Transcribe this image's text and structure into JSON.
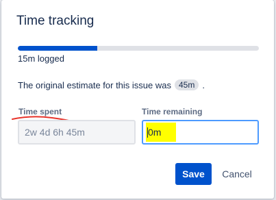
{
  "dialog": {
    "title": "Time tracking",
    "progress_fraction": 0.33,
    "logged_text": "15m logged",
    "estimate_text": "The original estimate for this issue was",
    "estimate_value": "45m",
    "estimate_suffix": "."
  },
  "fields": {
    "time_spent": {
      "label": "Time spent",
      "placeholder": "2w 4d 6h 45m"
    },
    "time_remaining": {
      "label": "Time remaining",
      "value": "0m"
    }
  },
  "actions": {
    "save_label": "Save",
    "cancel_label": "Cancel"
  },
  "colors": {
    "accent": "#0052cc",
    "focus_border": "#4c9aff",
    "highlight": "#ffff00",
    "annotation": "#e8332a"
  }
}
